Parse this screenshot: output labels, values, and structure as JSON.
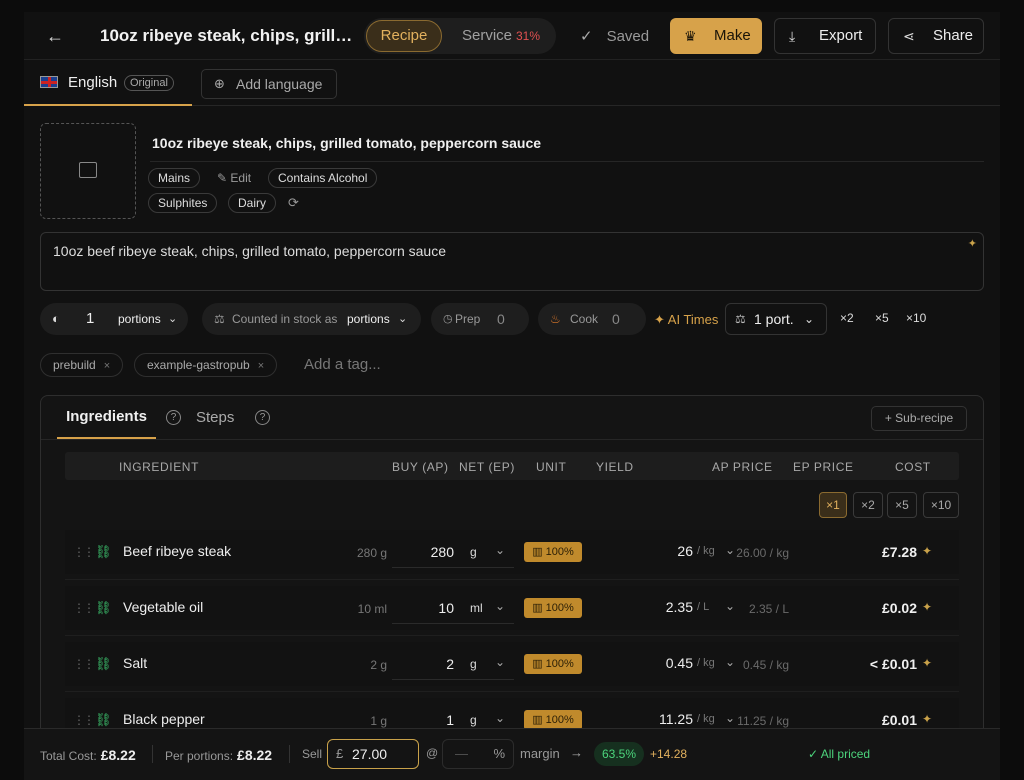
{
  "topbar": {
    "title": "10oz ribeye steak, chips, grilled t...",
    "tab_recipe": "Recipe",
    "tab_service": "Service",
    "service_pct": "31%",
    "saved": "Saved",
    "make": "Make",
    "export": "Export",
    "share": "Share"
  },
  "language": {
    "current": "English",
    "original_badge": "Original",
    "add_language": "Add language"
  },
  "recipe": {
    "name": "10oz ribeye steak, chips, grilled tomato, peppercorn sauce",
    "category": "Mains",
    "edit": "Edit",
    "allergens": [
      "Contains Alcohol",
      "Sulphites",
      "Dairy"
    ],
    "description": "10oz beef ribeye steak, chips, grilled tomato, peppercorn sauce"
  },
  "portions": {
    "count": "1",
    "unit": "portions",
    "stock_label": "Counted in stock as",
    "stock_unit": "portions",
    "prep_label": "Prep",
    "prep_value": "0",
    "cook_label": "Cook",
    "cook_value": "0",
    "ai_times": "AI Times",
    "scale_value": "1 port.",
    "multipliers": [
      "×2",
      "×5",
      "×10"
    ]
  },
  "tags": {
    "items": [
      "prebuild",
      "example-gastropub"
    ],
    "placeholder": "Add a tag..."
  },
  "ingredients_card": {
    "tab_ingredients": "Ingredients",
    "tab_steps": "Steps",
    "sub_recipe": "Sub-recipe",
    "columns": [
      "INGREDIENT",
      "BUY (AP)",
      "NET (EP)",
      "UNIT",
      "YIELD",
      "AP PRICE",
      "EP PRICE",
      "COST"
    ],
    "multipliers": [
      "×1",
      "×2",
      "×5",
      "×10"
    ],
    "rows": [
      {
        "name": "Beef ribeye steak",
        "buy": "280 g",
        "net": "280",
        "unit": "g",
        "yield": "100%",
        "ap_price": "26",
        "ap_unit": "/ kg",
        "ep_price": "26.00",
        "ep_unit": "/ kg",
        "cost": "£7.28"
      },
      {
        "name": "Vegetable oil",
        "buy": "10 ml",
        "net": "10",
        "unit": "ml",
        "yield": "100%",
        "ap_price": "2.35",
        "ap_unit": "/ L",
        "ep_price": "2.35",
        "ep_unit": "/ L",
        "cost": "£0.02"
      },
      {
        "name": "Salt",
        "buy": "2 g",
        "net": "2",
        "unit": "g",
        "yield": "100%",
        "ap_price": "0.45",
        "ap_unit": "/ kg",
        "ep_price": "0.45",
        "ep_unit": "/ kg",
        "cost": "< £0.01"
      },
      {
        "name": "Black pepper",
        "buy": "1 g",
        "net": "1",
        "unit": "g",
        "yield": "100%",
        "ap_price": "11.25",
        "ap_unit": "/ kg",
        "ep_price": "11.25",
        "ep_unit": "/ kg",
        "cost": "£0.01"
      }
    ]
  },
  "footer": {
    "total_label": "Total Cost:",
    "total_value": "£8.22",
    "per_label": "Per portions:",
    "per_value": "£8.22",
    "sell_label": "Sell",
    "currency": "£",
    "sell_value": "27.00",
    "at": "@",
    "margin_placeholder": "—",
    "pct_sign": "%",
    "margin_label": "margin",
    "margin_pct": "63.5%",
    "margin_delta": "+14.28",
    "all_priced": "✓ All priced"
  }
}
